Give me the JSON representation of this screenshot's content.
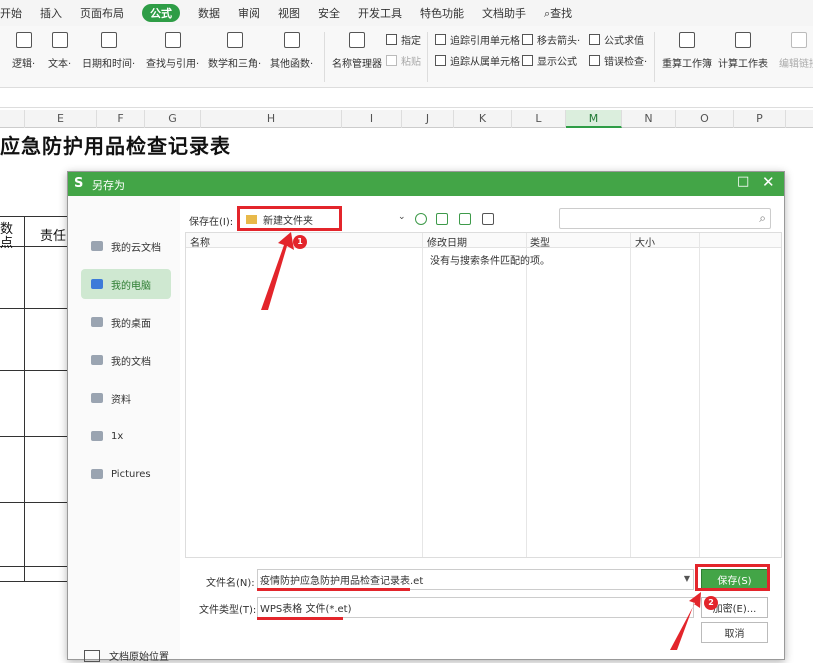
{
  "menubar": {
    "items": [
      "开始",
      "插入",
      "页面布局",
      "公式",
      "数据",
      "审阅",
      "视图",
      "安全",
      "开发工具",
      "特色功能",
      "文档助手"
    ],
    "active_index": 3,
    "search_label": "查找"
  },
  "ribbon": {
    "buttons": [
      "逻辑·",
      "文本·",
      "日期和时间·",
      "查找与引用·",
      "数学和三角·",
      "其他函数·",
      "名称管理器",
      "重算工作簿",
      "计算工作表",
      "编辑链接"
    ],
    "small": {
      "specify": "指定",
      "paste": "粘贴",
      "trace_precedents": "追踪引用单元格",
      "trace_dependents": "追踪从属单元格",
      "remove_arrows": "移去箭头·",
      "show_formulas": "显示公式",
      "formula_eval": "公式求值",
      "error_check": "错误检查·"
    }
  },
  "columns": [
    "E",
    "F",
    "G",
    "H",
    "I",
    "J",
    "K",
    "L",
    "M",
    "N",
    "O",
    "P"
  ],
  "active_column": "M",
  "sheet": {
    "title": "应急防护用品检查记录表",
    "cell1_line1": "数",
    "cell1_line2": "点",
    "cell2": "责任"
  },
  "dialog": {
    "logo": "S",
    "title": "另存为",
    "max_icon": "□",
    "close_icon": "✕",
    "sidebar": [
      "我的云文档",
      "我的电脑",
      "我的桌面",
      "我的文档",
      "资料",
      "1x",
      "Pictures"
    ],
    "sidebar_active_index": 1,
    "sidebar_footer": "文档原始位置",
    "save_in_label": "保存在(I):",
    "save_in_value": "新建文件夹",
    "columns": [
      "名称",
      "修改日期",
      "类型",
      "大小"
    ],
    "empty_message": "没有与搜索条件匹配的项。",
    "filename_label": "文件名(N):",
    "filename_value": "疫情防护应急防护用品检查记录表.et",
    "filetype_label": "文件类型(T):",
    "filetype_value": "WPS表格 文件(*.et)",
    "save_button": "保存(S)",
    "encrypt_button": "加密(E)...",
    "cancel_button": "取消"
  },
  "annotations": {
    "badge1": "1",
    "badge2": "2",
    "color": "#e3252b"
  }
}
